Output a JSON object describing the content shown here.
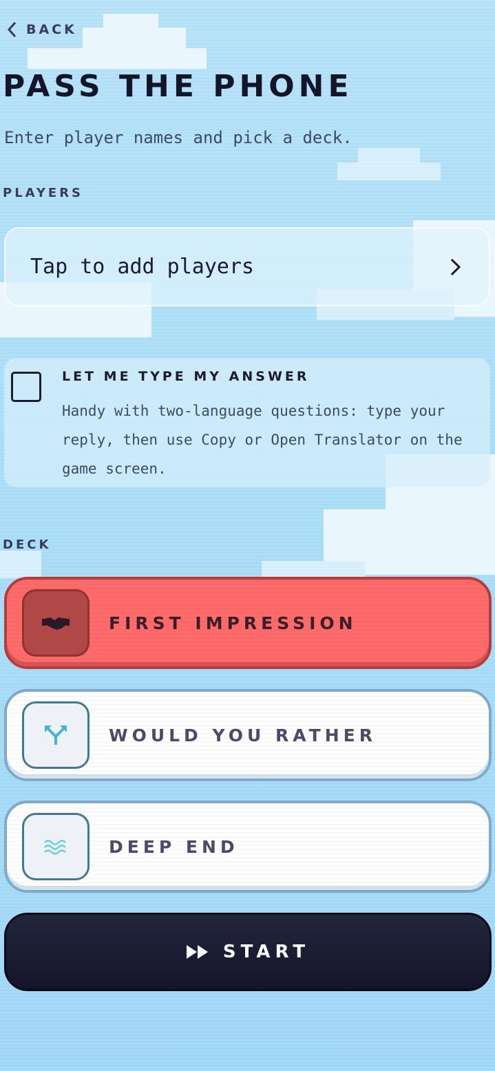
{
  "header": {
    "back_label": "BACK",
    "title": "PASS THE PHONE",
    "subtitle": "Enter player names and pick a deck."
  },
  "players": {
    "section_label": "PLAYERS",
    "placeholder": "Tap to add players"
  },
  "type_answer": {
    "title": "LET ME TYPE MY ANSWER",
    "description": "Handy with two-language questions: type your reply, then use Copy or Open Translator on the game screen.",
    "checked": false
  },
  "deck": {
    "section_label": "DECK",
    "selected": "FIRST IMPRESSION",
    "items": [
      {
        "label": "FIRST IMPRESSION",
        "icon": "handshake-icon",
        "selected": true
      },
      {
        "label": "WOULD YOU RATHER",
        "icon": "split-arrows-icon",
        "selected": false
      },
      {
        "label": "DEEP END",
        "icon": "waves-icon",
        "selected": false
      }
    ]
  },
  "start": {
    "label": "START",
    "icon": "fast-forward-icon"
  },
  "colors": {
    "selected_deck": "#ff6b6b",
    "start_button": "#1a1b30",
    "sky": "#a9dcf6"
  }
}
